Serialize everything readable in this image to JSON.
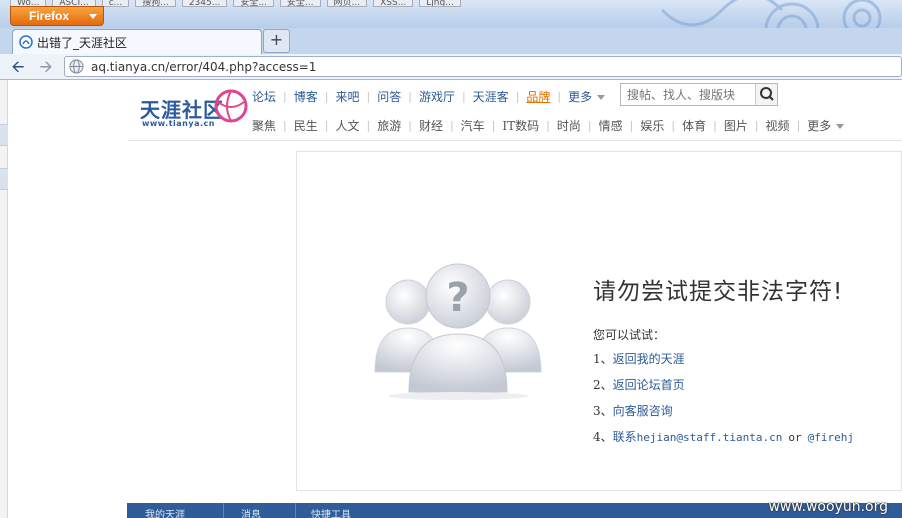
{
  "browser": {
    "app_button": "Firefox",
    "tab_title": "出错了_天涯社区",
    "url": "aq.tianya.cn/error/404.php?access=1",
    "background_tabs": [
      "Wo...",
      "ASCI...",
      "c...",
      "搜狗...",
      "2345...",
      "安全...",
      "安全...",
      "网页...",
      "XSS...",
      "Ljng..."
    ]
  },
  "site": {
    "logo_text": "天涯社区",
    "logo_subtext": "www.tianya.cn",
    "nav_primary": [
      "论坛",
      "博客",
      "来吧",
      "问答",
      "游戏厅",
      "天涯客",
      "品牌",
      "更多"
    ],
    "nav_primary_highlight": "品牌",
    "search_placeholder": "搜帖、找人、搜版块",
    "nav_secondary": [
      "聚焦",
      "民生",
      "人文",
      "旅游",
      "财经",
      "汽车",
      "IT数码",
      "时尚",
      "情感",
      "娱乐",
      "体育",
      "图片",
      "视频",
      "更多"
    ]
  },
  "error": {
    "title": "请勿尝试提交非法字符!",
    "hint": "您可以试试：",
    "options": {
      "o1": {
        "num": "1、",
        "link": "返回我的天涯"
      },
      "o2": {
        "num": "2、",
        "link": "返回论坛首页"
      },
      "o3": {
        "num": "3、",
        "link": "向客服咨询"
      },
      "o4": {
        "num": "4、",
        "link_prefix": "联系",
        "email": "hejian@staff.tianta.cn",
        "or": "or",
        "handle": "@firehj"
      }
    }
  },
  "bottom_bar": [
    "我的天涯",
    "消息",
    "快捷工具"
  ],
  "watermark": "www.wooyun.org",
  "colors": {
    "link_blue": "#2b5b96",
    "firefox_orange": "#e66a0c",
    "brand_hot": "#e07000",
    "bottom_bar": "#2f5d99"
  }
}
